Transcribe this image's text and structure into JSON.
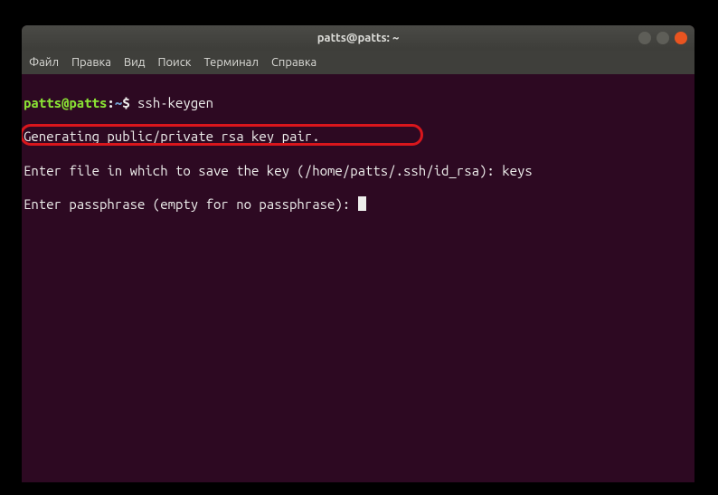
{
  "window": {
    "title": "patts@patts: ~"
  },
  "menubar": {
    "file": "Файл",
    "edit": "Правка",
    "view": "Вид",
    "search": "Поиск",
    "terminal": "Терминал",
    "help": "Справка"
  },
  "prompt": {
    "user_host": "patts@patts",
    "sep1": ":",
    "path": "~",
    "sep2": "$"
  },
  "terminal": {
    "command": " ssh-keygen",
    "line1": "Generating public/private rsa key pair.",
    "line2": "Enter file in which to save the key (/home/patts/.ssh/id_rsa): keys",
    "line3": "Enter passphrase (empty for no passphrase): "
  }
}
